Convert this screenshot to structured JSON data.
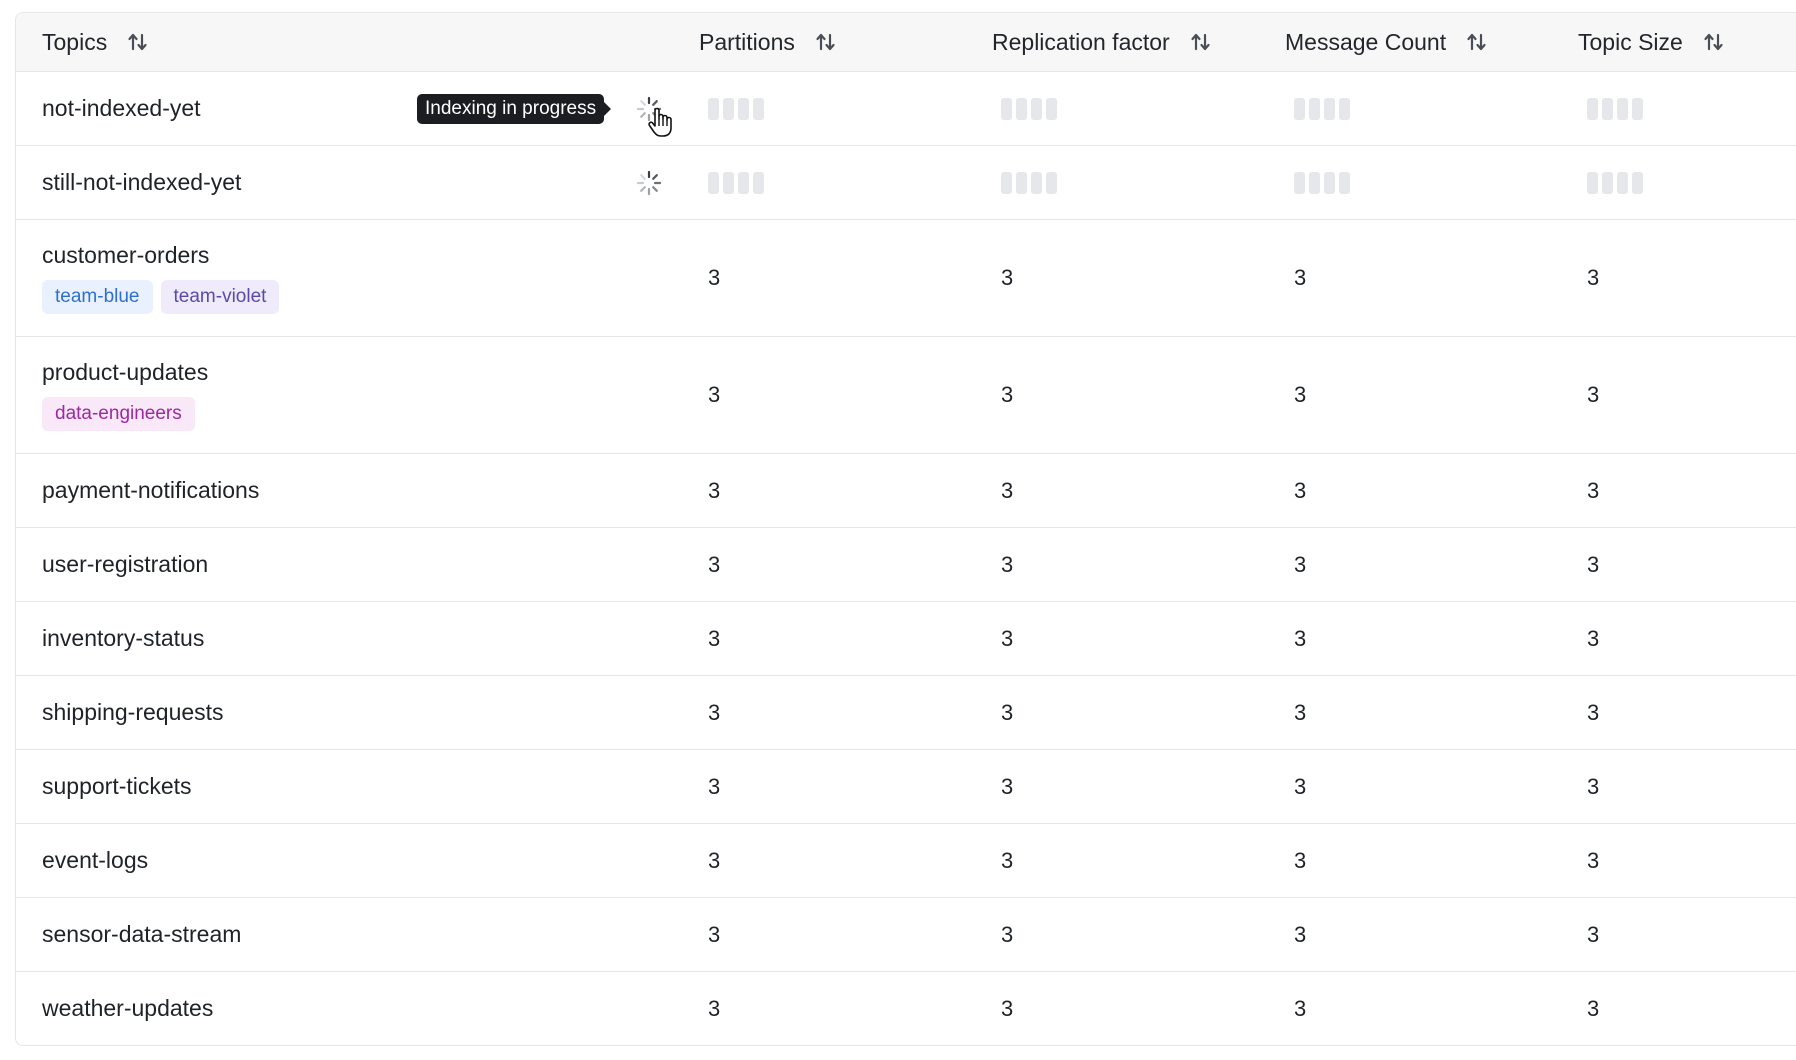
{
  "columns": {
    "topics": "Topics",
    "partitions": "Partitions",
    "replication": "Replication factor",
    "messages": "Message Count",
    "size": "Topic Size"
  },
  "tooltip": "Indexing in progress",
  "rows": [
    {
      "name": "not-indexed-yet",
      "indexing": true
    },
    {
      "name": "still-not-indexed-yet",
      "indexing": true
    },
    {
      "name": "customer-orders",
      "tags": [
        "team-blue",
        "team-violet"
      ],
      "partitions": "3",
      "replication": "3",
      "messages": "3",
      "size": "3"
    },
    {
      "name": "product-updates",
      "tags": [
        "data-engineers"
      ],
      "partitions": "3",
      "replication": "3",
      "messages": "3",
      "size": "3"
    },
    {
      "name": "payment-notifications",
      "partitions": "3",
      "replication": "3",
      "messages": "3",
      "size": "3"
    },
    {
      "name": "user-registration",
      "partitions": "3",
      "replication": "3",
      "messages": "3",
      "size": "3"
    },
    {
      "name": "inventory-status",
      "partitions": "3",
      "replication": "3",
      "messages": "3",
      "size": "3"
    },
    {
      "name": "shipping-requests",
      "partitions": "3",
      "replication": "3",
      "messages": "3",
      "size": "3"
    },
    {
      "name": "support-tickets",
      "partitions": "3",
      "replication": "3",
      "messages": "3",
      "size": "3"
    },
    {
      "name": "event-logs",
      "partitions": "3",
      "replication": "3",
      "messages": "3",
      "size": "3"
    },
    {
      "name": "sensor-data-stream",
      "partitions": "3",
      "replication": "3",
      "messages": "3",
      "size": "3"
    },
    {
      "name": "weather-updates",
      "partitions": "3",
      "replication": "3",
      "messages": "3",
      "size": "3"
    }
  ],
  "colors": {
    "tag_blue_bg": "#e8f1fd",
    "tag_violet_bg": "#efebfa",
    "tag_pink_bg": "#f8e8f8",
    "skeleton": "#e6e7ea"
  },
  "icons": {
    "sort": "sort-arrows-icon",
    "loading": "spinner-icon",
    "cursor": "pointer-hand-icon"
  }
}
